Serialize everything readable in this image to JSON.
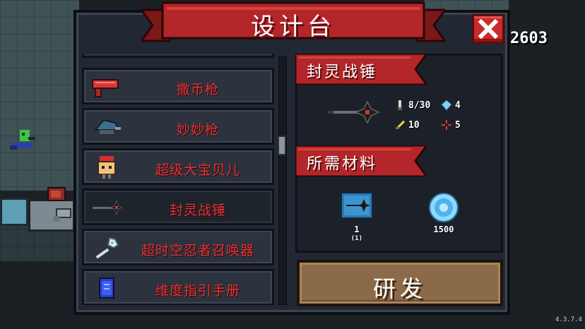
{
  "window": {
    "title": "设计台"
  },
  "hud": {
    "coins": "2603",
    "version": "4.3.7.4"
  },
  "list": {
    "items": [
      {
        "label": "撒币枪",
        "icon": "red-coin-gun-icon",
        "selected": false
      },
      {
        "label": "妙妙枪",
        "icon": "cat-gun-icon",
        "selected": false
      },
      {
        "label": "超级大宝贝儿",
        "icon": "baby-pet-icon",
        "selected": false
      },
      {
        "label": "封灵战锤",
        "icon": "war-hammer-icon",
        "selected": true
      },
      {
        "label": "超时空忍者召唤器",
        "icon": "ninja-summoner-icon",
        "selected": false
      },
      {
        "label": "维度指引手册",
        "icon": "dimension-manual-icon",
        "selected": false
      }
    ]
  },
  "detail": {
    "name": "封灵战锤",
    "stats": {
      "ammo": "8/30",
      "energy": "4",
      "damage": "10",
      "critical": "5"
    },
    "materials_title": "所需材料",
    "materials": [
      {
        "icon": "blueprint-icon",
        "count": "1",
        "sub": "(1)"
      },
      {
        "icon": "gem-icon",
        "count": "1500"
      }
    ]
  },
  "buttons": {
    "research": "研发",
    "close": "close"
  },
  "colors": {
    "ribbon_red": "#b3262a",
    "label_red": "#e03636",
    "button_brown": "#8b6a4a",
    "panel_bg": "#222833"
  }
}
